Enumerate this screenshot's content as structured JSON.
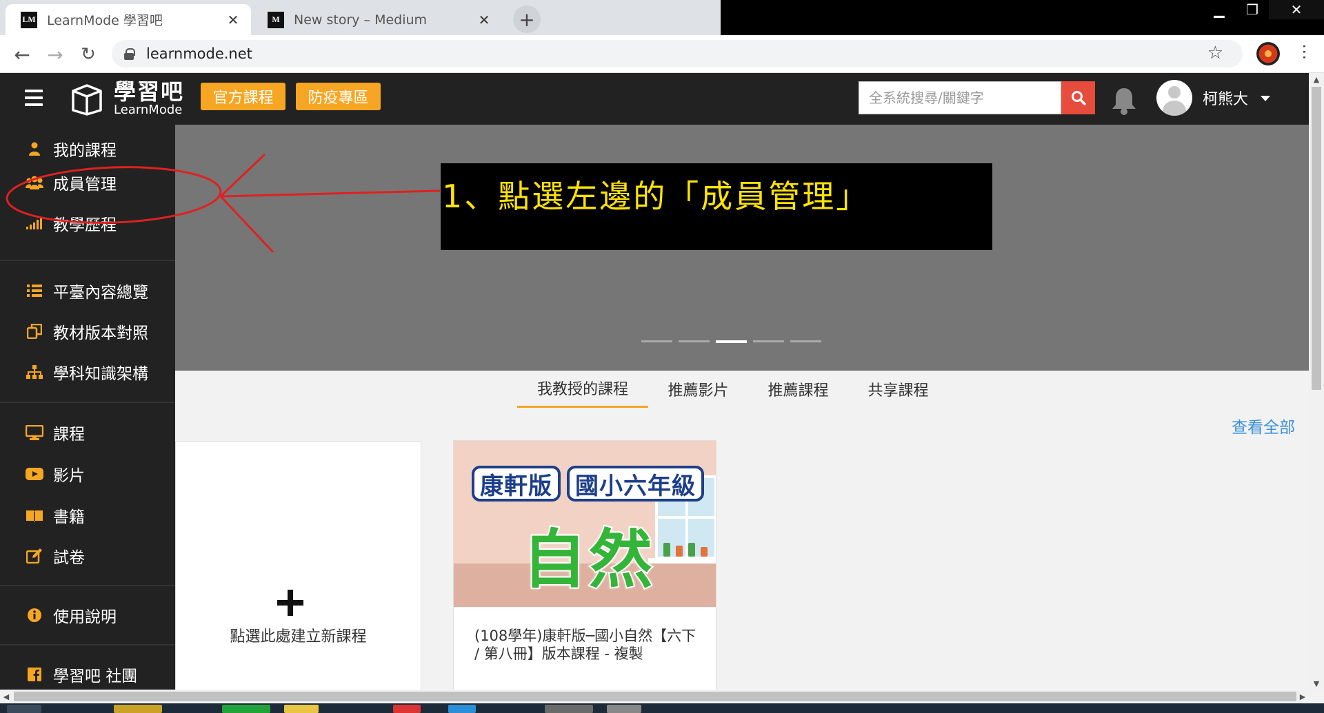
{
  "browser": {
    "tabs": [
      {
        "icon": "LM",
        "title": "LearnMode 學習吧",
        "active": true
      },
      {
        "icon": "M",
        "title": "New story – Medium",
        "active": false
      }
    ],
    "new_tab_label": "+",
    "url": "learnmode.net"
  },
  "site": {
    "logo_zh": "學習吧",
    "logo_en": "LearnMode",
    "official_courses": "官方課程",
    "epidemic_zone": "防疫專區",
    "search_placeholder": "全系統搜尋/關鍵字",
    "username": "柯熊大"
  },
  "sidebar": {
    "items": [
      {
        "label": "我的課程",
        "icon": "user-icon"
      },
      {
        "label": "成員管理",
        "icon": "users-icon"
      },
      {
        "label": "教學歷程",
        "icon": "signal-bars-icon"
      },
      {
        "label": "平臺內容總覽",
        "icon": "list-icon"
      },
      {
        "label": "教材版本對照",
        "icon": "copy-icon"
      },
      {
        "label": "學科知識架構",
        "icon": "sitemap-icon"
      },
      {
        "label": "課程",
        "icon": "desktop-icon"
      },
      {
        "label": "影片",
        "icon": "youtube-icon"
      },
      {
        "label": "書籍",
        "icon": "book-icon"
      },
      {
        "label": "試卷",
        "icon": "edit-icon"
      },
      {
        "label": "使用說明",
        "icon": "info-icon"
      },
      {
        "label": "學習吧 社團",
        "icon": "facebook-icon"
      }
    ]
  },
  "annotation": {
    "callout_text": "1、點選左邊的「成員管理」",
    "color": "#e02020"
  },
  "content": {
    "tabs": [
      "我教授的課程",
      "推薦影片",
      "推薦課程",
      "共享課程"
    ],
    "view_all": "查看全部",
    "new_course_label": "點選此處建立新課程",
    "course_card": {
      "badge_1": "康軒版",
      "badge_2": "國小六年級",
      "subject": "自然",
      "title": "(108學年)康軒版─國小自然【六下 / 第八冊】版本課程 - 複製"
    }
  },
  "colors": {
    "accent": "#f6a623",
    "header_bg": "#222222",
    "search_button": "#e74c3c",
    "link": "#3a8fd8",
    "callout_text": "#ffe400"
  }
}
